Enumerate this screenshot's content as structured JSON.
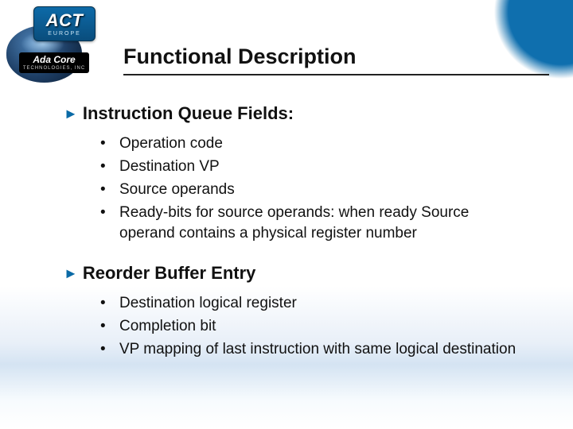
{
  "logo": {
    "act_big": "ACT",
    "act_small": "EUROPE",
    "adacore_line1": "Ada Core",
    "adacore_line2": "TECHNOLOGIES, INC"
  },
  "title": "Functional Description",
  "sections": [
    {
      "heading": "Instruction Queue Fields:",
      "items": [
        "Operation code",
        "Destination VP",
        "Source operands",
        "Ready-bits for source operands:\nwhen ready Source operand contains a physical register number"
      ]
    },
    {
      "heading": "Reorder Buffer Entry",
      "items": [
        "Destination logical register",
        "Completion bit",
        "VP mapping of last instruction with same logical destination"
      ]
    }
  ]
}
